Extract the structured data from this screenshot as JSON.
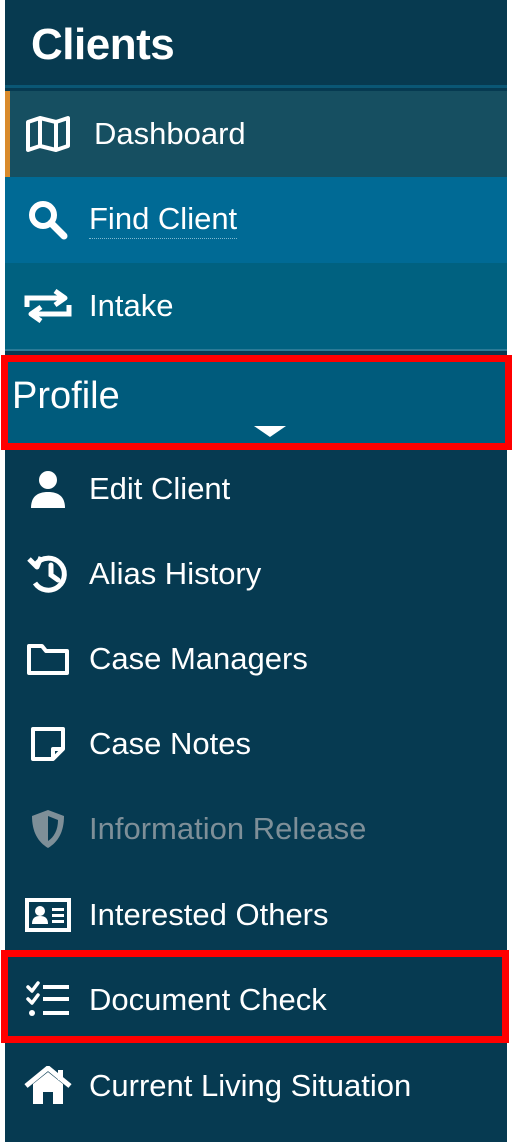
{
  "sidebar": {
    "title": "Clients",
    "top_items": [
      {
        "label": "Dashboard",
        "icon": "map-icon"
      },
      {
        "label": "Find Client",
        "icon": "search-icon"
      },
      {
        "label": "Intake",
        "icon": "exchange-arrows-icon"
      }
    ],
    "profile": {
      "title": "Profile",
      "items": [
        {
          "label": "Edit Client",
          "icon": "user-icon"
        },
        {
          "label": "Alias History",
          "icon": "history-icon"
        },
        {
          "label": "Case Managers",
          "icon": "folder-icon"
        },
        {
          "label": "Case Notes",
          "icon": "sticky-note-icon"
        },
        {
          "label": "Information Release",
          "icon": "shield-icon",
          "disabled": true
        },
        {
          "label": "Interested Others",
          "icon": "id-card-icon"
        },
        {
          "label": "Document Check",
          "icon": "checklist-icon"
        },
        {
          "label": "Current Living Situation",
          "icon": "home-icon"
        }
      ]
    }
  },
  "colors": {
    "sidebar_bg": "#063a51",
    "active_bg": "#164f61",
    "active_accent": "#d98a2b",
    "hover_bg": "#006a95",
    "profile_bg": "#005b7c",
    "highlight": "#ff0000"
  }
}
